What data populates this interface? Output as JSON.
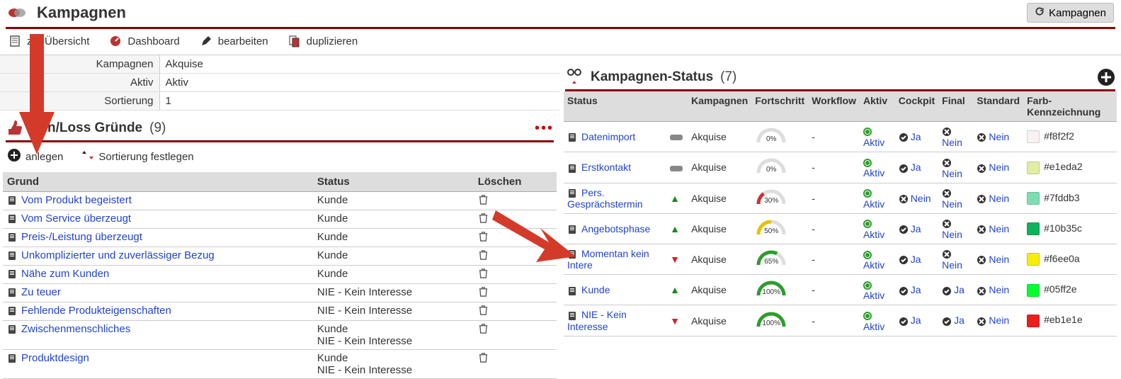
{
  "header": {
    "title": "Kampagnen",
    "refresh_label": "Kampagnen"
  },
  "toolbar": {
    "overview": "zur Übersicht",
    "dashboard": "Dashboard",
    "edit": "bearbeiten",
    "duplicate": "duplizieren"
  },
  "props": {
    "kampagnen_label": "Kampagnen",
    "kampagnen_value": "Akquise",
    "aktiv_label": "Aktiv",
    "aktiv_value": "Aktiv",
    "sort_label": "Sortierung",
    "sort_value": "1"
  },
  "winloss": {
    "title": "Win/Loss Gründe",
    "count": "(9)",
    "anlegen": "anlegen",
    "sortierung": "Sortierung festlegen",
    "columns": {
      "grund": "Grund",
      "status": "Status",
      "loeschen": "Löschen"
    },
    "rows": [
      {
        "grund": "Vom Produkt begeistert",
        "status": [
          "Kunde"
        ]
      },
      {
        "grund": "Vom Service überzeugt",
        "status": [
          "Kunde"
        ]
      },
      {
        "grund": "Preis-/Leistung überzeugt",
        "status": [
          "Kunde"
        ]
      },
      {
        "grund": "Unkomplizierter und zuverlässiger Bezug",
        "status": [
          "Kunde"
        ]
      },
      {
        "grund": "Nähe zum Kunden",
        "status": [
          "Kunde"
        ]
      },
      {
        "grund": "Zu teuer",
        "status": [
          "NIE - Kein Interesse"
        ]
      },
      {
        "grund": "Fehlende Produkteigenschaften",
        "status": [
          "NIE - Kein Interesse"
        ]
      },
      {
        "grund": "Zwischenmenschliches",
        "status": [
          "Kunde",
          "NIE - Kein Interesse"
        ]
      },
      {
        "grund": "Produktdesign",
        "status": [
          "Kunde",
          "NIE - Kein Interesse"
        ]
      }
    ]
  },
  "kstatus": {
    "title": "Kampagnen-Status",
    "count": "(7)",
    "columns": {
      "status": "Status",
      "kampagnen": "Kampagnen",
      "fortschritt": "Fortschritt",
      "workflow": "Workflow",
      "aktiv": "Aktiv",
      "cockpit": "Cockpit",
      "final": "Final",
      "standard": "Standard",
      "farb": "Farb-Kennzeichnung"
    },
    "rows": [
      {
        "status": "Datenimport",
        "icon": "minus",
        "kampagne": "Akquise",
        "pct": 0,
        "arc_color": "#bbb",
        "workflow": "-",
        "aktiv": "Aktiv",
        "cockpit": "Ja",
        "final": "Nein",
        "standard": "Nein",
        "color": "#f8f2f2"
      },
      {
        "status": "Erstkontakt",
        "icon": "minus",
        "kampagne": "Akquise",
        "pct": 0,
        "arc_color": "#bbb",
        "workflow": "-",
        "aktiv": "Aktiv",
        "cockpit": "Ja",
        "final": "Nein",
        "standard": "Nein",
        "color": "#e1eda2"
      },
      {
        "status": "Pers. Gesprächstermin",
        "icon": "up",
        "kampagne": "Akquise",
        "pct": 30,
        "arc_color": "#cc3333",
        "workflow": "-",
        "aktiv": "Aktiv",
        "cockpit": "Nein",
        "final": "Nein",
        "standard": "Nein",
        "color": "#7fddb3"
      },
      {
        "status": "Angebotsphase",
        "icon": "up",
        "kampagne": "Akquise",
        "pct": 50,
        "arc_color": "#e6c200",
        "workflow": "-",
        "aktiv": "Aktiv",
        "cockpit": "Ja",
        "final": "Nein",
        "standard": "Nein",
        "color": "#10b35c"
      },
      {
        "status": "Momentan kein Intere",
        "icon": "down",
        "kampagne": "Akquise",
        "pct": 65,
        "arc_color": "#2e9c2e",
        "workflow": "-",
        "aktiv": "Aktiv",
        "cockpit": "Ja",
        "final": "Nein",
        "standard": "Nein",
        "color": "#f6ee0a"
      },
      {
        "status": "Kunde",
        "icon": "up",
        "kampagne": "Akquise",
        "pct": 100,
        "arc_color": "#2e9c2e",
        "workflow": "-",
        "aktiv": "Aktiv",
        "cockpit": "Ja",
        "final": "Ja",
        "standard": "Nein",
        "color": "#05ff2e"
      },
      {
        "status": "NIE - Kein Interesse",
        "icon": "down",
        "kampagne": "Akquise",
        "pct": 100,
        "arc_color": "#2e9c2e",
        "workflow": "-",
        "aktiv": "Aktiv",
        "cockpit": "Ja",
        "final": "Ja",
        "standard": "Nein",
        "color": "#eb1e1e"
      }
    ]
  }
}
